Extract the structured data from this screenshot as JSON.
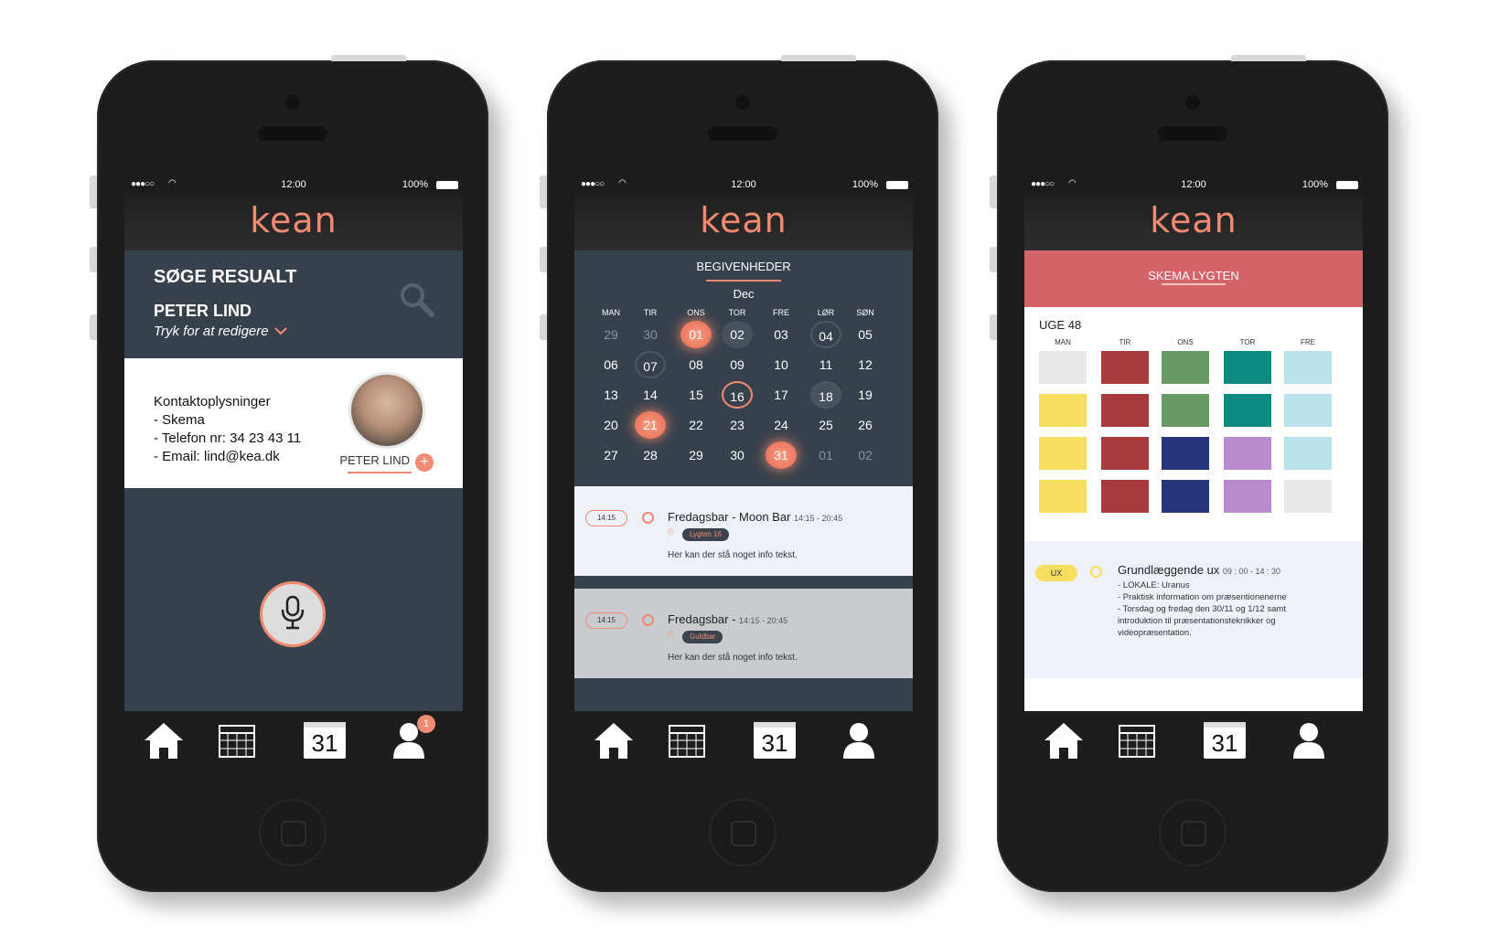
{
  "status": {
    "time": "12:00",
    "battery": "100%"
  },
  "brand": "kean",
  "tabbar": {
    "calendar_day": "31",
    "notification_count": "1"
  },
  "phone1": {
    "title": "SØGE RESUALT",
    "name": "PETER LIND",
    "hint": "Tryk for at redigere",
    "contact_lines": [
      "Kontaktoplysninger",
      "- Skema",
      "- Telefon nr: 34 23 43 11",
      "- Email: lind@kea.dk"
    ],
    "avatar_name": "PETER LIND",
    "plus": "+"
  },
  "phone2": {
    "title": "BEGIVENHEDER",
    "month": "Dec",
    "weekdays": [
      "MAN",
      "TIR",
      "ONS",
      "TOR",
      "FRE",
      "LØR",
      "SØN"
    ],
    "weeks": [
      [
        "29",
        "30",
        "01",
        "02",
        "03",
        "04",
        "05"
      ],
      [
        "06",
        "07",
        "08",
        "09",
        "10",
        "11",
        "12"
      ],
      [
        "13",
        "14",
        "15",
        "16",
        "17",
        "18",
        "19"
      ],
      [
        "20",
        "21",
        "22",
        "23",
        "24",
        "25",
        "26"
      ],
      [
        "27",
        "28",
        "29",
        "30",
        "31",
        "01",
        "02"
      ]
    ],
    "events": [
      {
        "time": "14:15",
        "title": "Fredagsbar - Moon Bar",
        "hours": "14:15 - 20:45",
        "location": "Lygten 16",
        "info": "Her kan der stå noget info tekst."
      },
      {
        "time": "14:15",
        "title": "Fredagsbar -",
        "hours": "14:15 - 20:45",
        "location": "Guldbar",
        "info": "Her kan der stå noget info tekst."
      }
    ]
  },
  "phone3": {
    "title": "SKEMA LYGTEN",
    "week": "UGE 48",
    "days": [
      "MAN",
      "TIR",
      "ONS",
      "TOR",
      "FRE"
    ],
    "colors": {
      "grey": "#e8e8e8",
      "red": "#a83a3e",
      "green": "#6a9a63",
      "teal": "#0f8a80",
      "lightblue": "#b9e2ec",
      "yellow": "#f6df5e",
      "navy": "#26357a",
      "purple": "#b98bcb"
    },
    "grid": [
      [
        "grey",
        "red",
        "green",
        "teal",
        "lightblue"
      ],
      [
        "yellow",
        "red",
        "green",
        "teal",
        "lightblue"
      ],
      [
        "yellow",
        "red",
        "navy",
        "purple",
        "lightblue"
      ],
      [
        "yellow",
        "red",
        "navy",
        "purple",
        "grey"
      ]
    ],
    "lesson": {
      "tag": "UX",
      "title": "Grundlæggende ux",
      "hours": "09 : 00 - 14 : 30",
      "lines": [
        "-  LOKALE: Uranus",
        "- Praktisk information om præsentionenerne",
        "- Torsdag og fredag den 30/11 og 1/12 samt",
        "introduktion til præsentationsteknikker og",
        "videopræsentation."
      ]
    }
  }
}
